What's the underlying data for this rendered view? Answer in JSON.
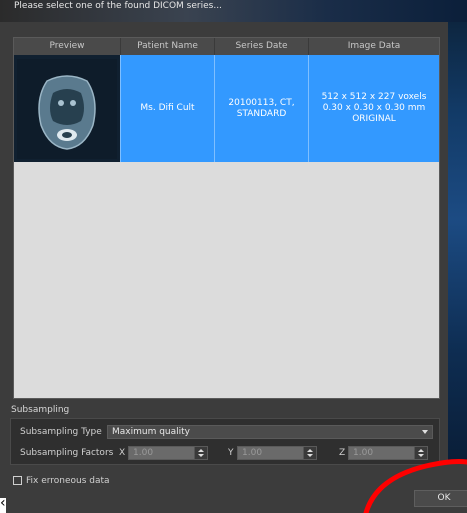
{
  "window": {
    "title": "Please select one of the found DICOM series..."
  },
  "table": {
    "columns": [
      "Preview",
      "Patient Name",
      "Series Date",
      "Image Data"
    ],
    "rows": [
      {
        "preview_icon": "ct-scan-thumbnail",
        "patient_name": "Ms. Difi Cult",
        "series_date": "20100113, CT,\nSTANDARD",
        "image_data": "512 x 512 x 227 voxels\n0.30 x 0.30 x 0.30 mm\nORIGINAL"
      }
    ]
  },
  "subsampling": {
    "section_label": "Subsampling",
    "type_label": "Subsampling Type",
    "type_value": "Maximum quality",
    "factors_label": "Subsampling Factors",
    "x_label": "X",
    "x_value": "1.00",
    "y_label": "Y",
    "y_value": "1.00",
    "z_label": "Z",
    "z_value": "1.00"
  },
  "options": {
    "fix_erroneous_label": "Fix erroneous data",
    "fix_erroneous_checked": false
  },
  "buttons": {
    "ok_label": "OK"
  },
  "colors": {
    "selection": "#3399ff",
    "annotation": "#ff0000"
  }
}
